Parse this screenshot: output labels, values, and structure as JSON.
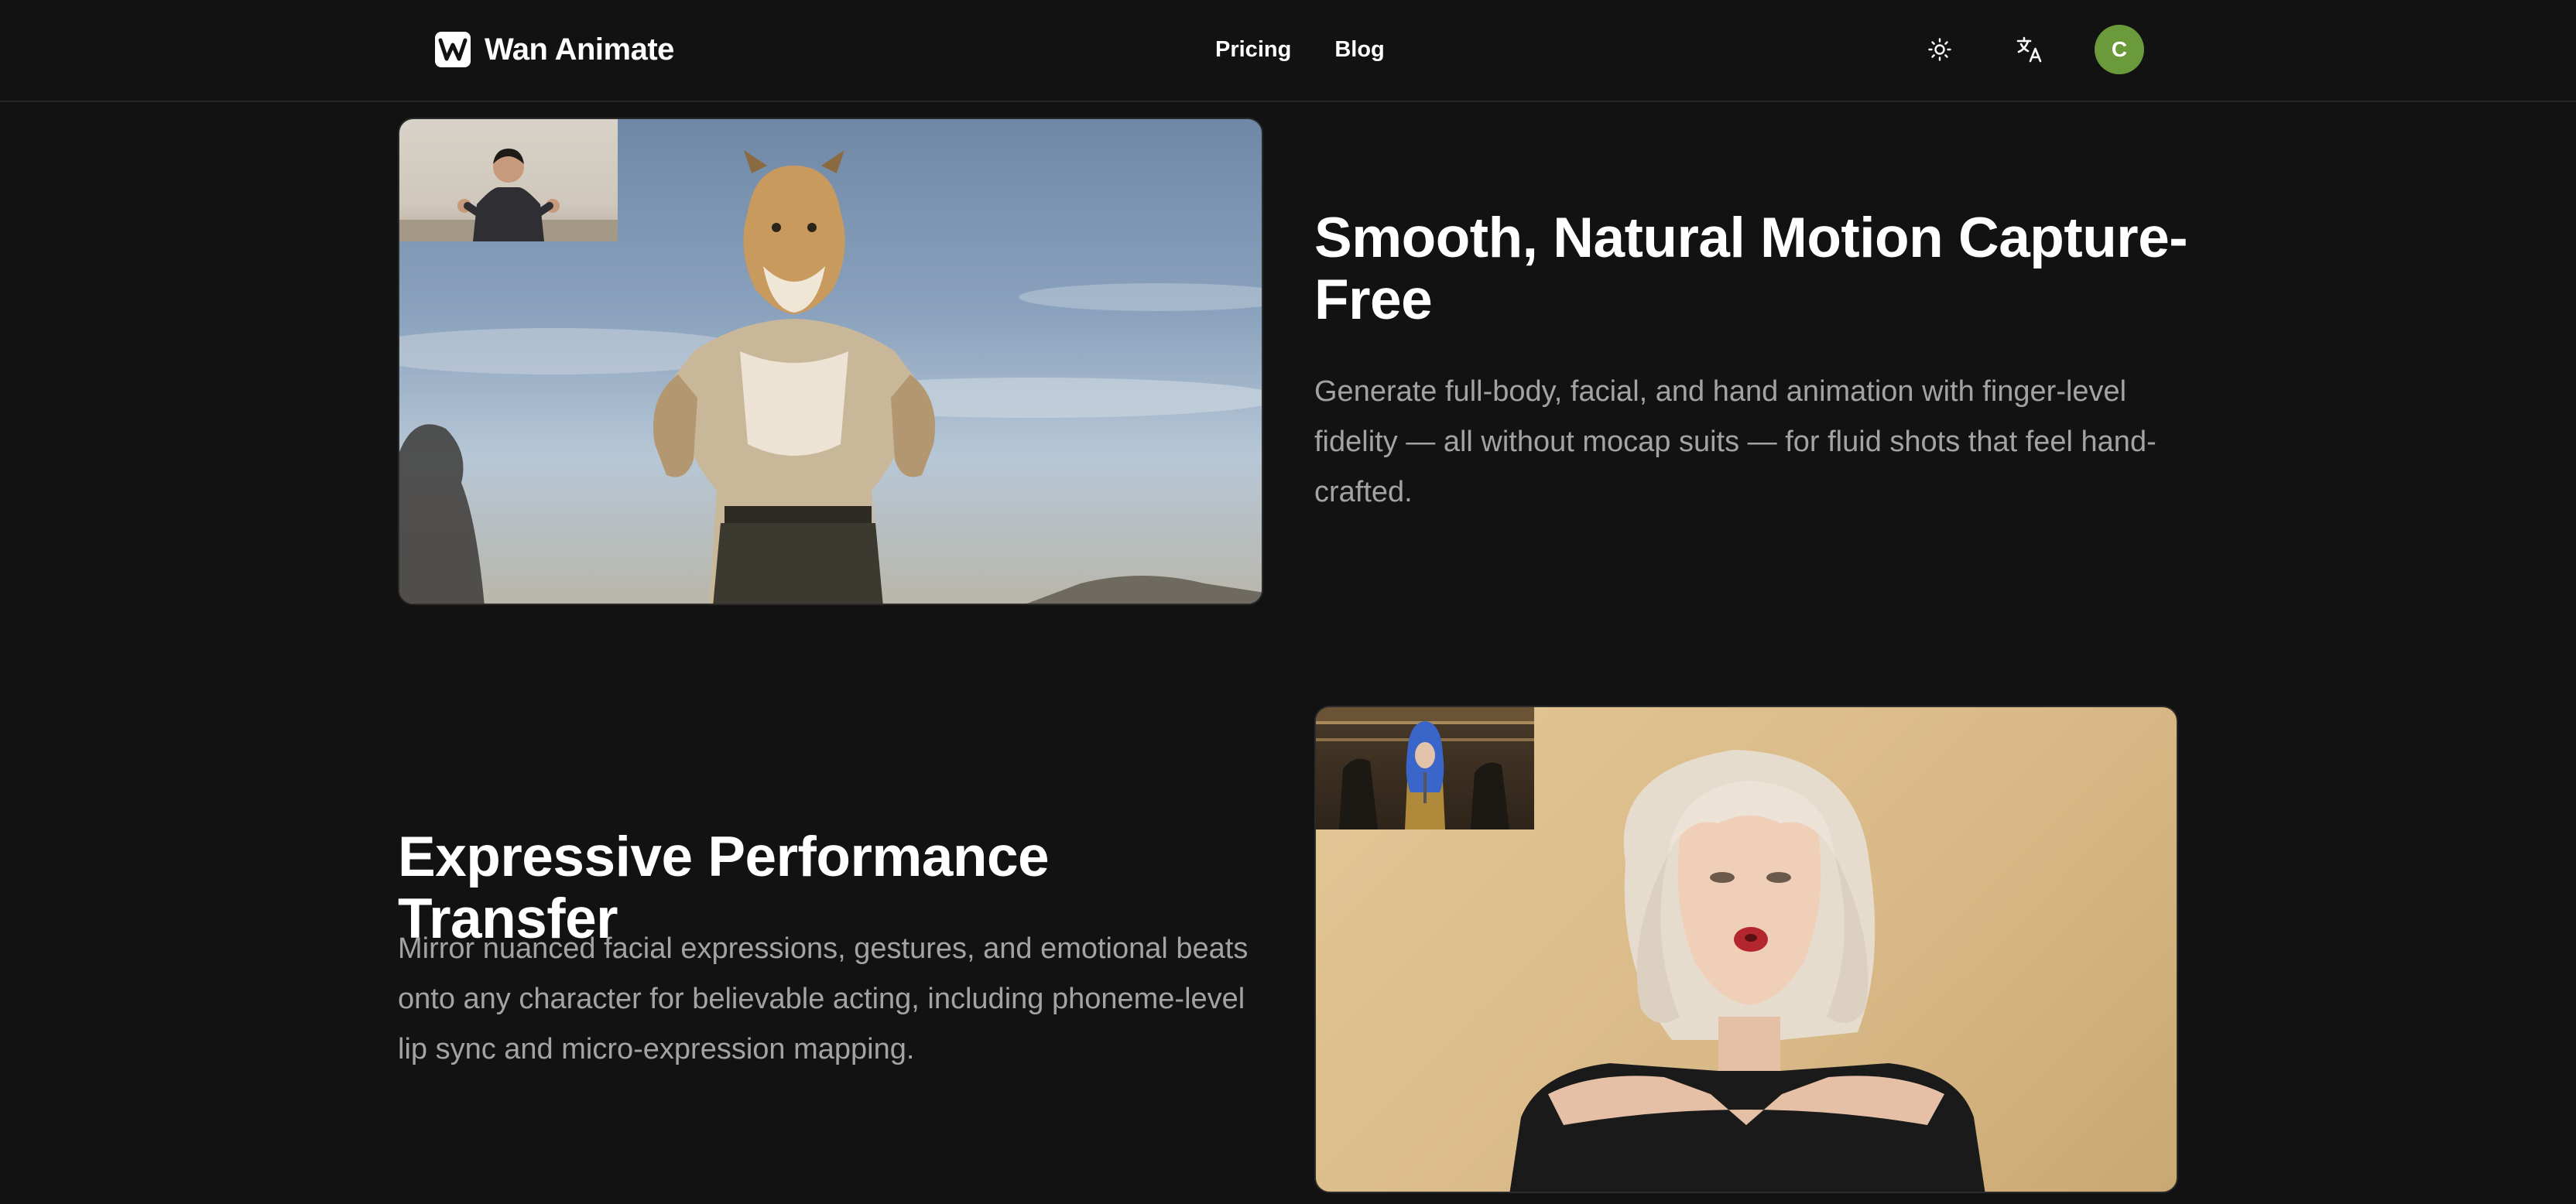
{
  "header": {
    "brand": "Wan Animate",
    "logo_letter": "W",
    "nav": [
      {
        "label": "Pricing"
      },
      {
        "label": "Blog"
      }
    ],
    "theme_icon": "sun-icon",
    "language_icon": "translate-icon",
    "avatar_initial": "C",
    "avatar_color": "#6b9a3a"
  },
  "features": [
    {
      "title": "Smooth, Natural Motion Capture-Free",
      "description": "Generate full-body, facial, and hand animation with finger-level fidelity — all without mocap suits — for fluid shots that feel hand-crafted."
    },
    {
      "title": "Expressive Performance Transfer",
      "description": "Mirror nuanced facial expressions, gestures, and emotional beats onto any character for believable acting, including phoneme-level lip sync and micro-expression mapping."
    }
  ]
}
